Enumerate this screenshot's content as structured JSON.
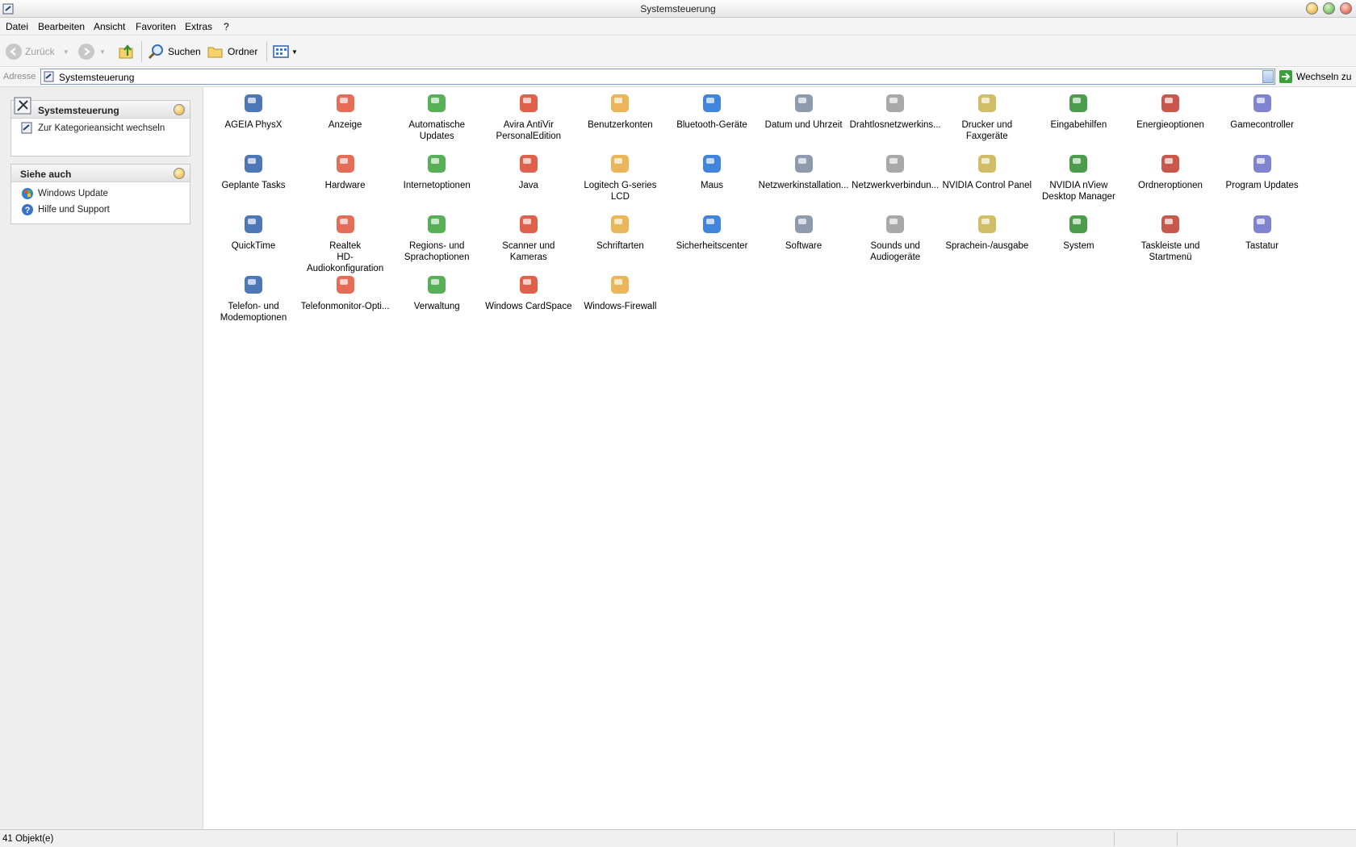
{
  "window": {
    "title": "Systemsteuerung"
  },
  "menu": [
    "Datei",
    "Bearbeiten",
    "Ansicht",
    "Favoriten",
    "Extras",
    "?"
  ],
  "toolbar": {
    "back": "Zurück",
    "search": "Suchen",
    "folders": "Ordner"
  },
  "address": {
    "label": "Adresse",
    "value": "Systemsteuerung",
    "go": "Wechseln zu"
  },
  "sidebar": {
    "panel1": {
      "title": "Systemsteuerung",
      "link": "Zur Kategorieansicht wechseln"
    },
    "panel2": {
      "title": "Siehe auch",
      "links": [
        "Windows Update",
        "Hilfe und Support"
      ]
    }
  },
  "items": [
    {
      "label": "AGEIA PhysX",
      "icon": "ageia-physx-icon"
    },
    {
      "label": "Anzeige",
      "icon": "display-icon"
    },
    {
      "label": "Automatische Updates",
      "icon": "automatic-updates-icon"
    },
    {
      "label": "Avira AntiVir\nPersonalEdition",
      "icon": "avira-icon"
    },
    {
      "label": "Benutzerkonten",
      "icon": "user-accounts-icon"
    },
    {
      "label": "Bluetooth-Geräte",
      "icon": "bluetooth-icon"
    },
    {
      "label": "Datum und Uhrzeit",
      "icon": "clock-icon"
    },
    {
      "label": "Drahtlosnetzwerkins...",
      "icon": "wireless-icon"
    },
    {
      "label": "Drucker und\nFaxgeräte",
      "icon": "printer-icon"
    },
    {
      "label": "Eingabehilfen",
      "icon": "accessibility-icon"
    },
    {
      "label": "Energieoptionen",
      "icon": "power-icon"
    },
    {
      "label": "Gamecontroller",
      "icon": "gamepad-icon"
    },
    {
      "label": "Geplante Tasks",
      "icon": "scheduled-tasks-icon"
    },
    {
      "label": "Hardware",
      "icon": "hardware-icon"
    },
    {
      "label": "Internetoptionen",
      "icon": "internet-options-icon"
    },
    {
      "label": "Java",
      "icon": "java-icon"
    },
    {
      "label": "Logitech G-series LCD",
      "icon": "lcd-icon"
    },
    {
      "label": "Maus",
      "icon": "mouse-icon"
    },
    {
      "label": "Netzwerkinstallation...",
      "icon": "network-setup-icon"
    },
    {
      "label": "Netzwerkverbindun...",
      "icon": "network-connections-icon"
    },
    {
      "label": "NVIDIA Control Panel",
      "icon": "nvidia-icon"
    },
    {
      "label": "NVIDIA nView\nDesktop Manager",
      "icon": "nvidia-nview-icon"
    },
    {
      "label": "Ordneroptionen",
      "icon": "folder-options-icon"
    },
    {
      "label": "Program Updates",
      "icon": "program-updates-icon"
    },
    {
      "label": "QuickTime",
      "icon": "quicktime-icon"
    },
    {
      "label": "Realtek\nHD-Audiokonfiguration",
      "icon": "realtek-audio-icon"
    },
    {
      "label": "Regions- und\nSprachoptionen",
      "icon": "globe-icon"
    },
    {
      "label": "Scanner und Kameras",
      "icon": "scanner-camera-icon"
    },
    {
      "label": "Schriftarten",
      "icon": "fonts-folder-icon"
    },
    {
      "label": "Sicherheitscenter",
      "icon": "security-shield-icon"
    },
    {
      "label": "Software",
      "icon": "software-icon"
    },
    {
      "label": "Sounds und\nAudiogeräte",
      "icon": "speaker-icon"
    },
    {
      "label": "Sprachein-/ausgabe",
      "icon": "speech-icon"
    },
    {
      "label": "System",
      "icon": "system-icon"
    },
    {
      "label": "Taskleiste und\nStartmenü",
      "icon": "taskbar-icon"
    },
    {
      "label": "Tastatur",
      "icon": "keyboard-icon"
    },
    {
      "label": "Telefon- und\nModemoptionen",
      "icon": "phone-modem-icon"
    },
    {
      "label": "Telefonmonitor-Opti...",
      "icon": "phone-monitor-icon"
    },
    {
      "label": "Verwaltung",
      "icon": "admin-tools-icon"
    },
    {
      "label": "Windows CardSpace",
      "icon": "cardspace-icon"
    },
    {
      "label": "Windows-Firewall",
      "icon": "firewall-icon"
    }
  ],
  "status": {
    "text": "41 Objekt(e)"
  }
}
